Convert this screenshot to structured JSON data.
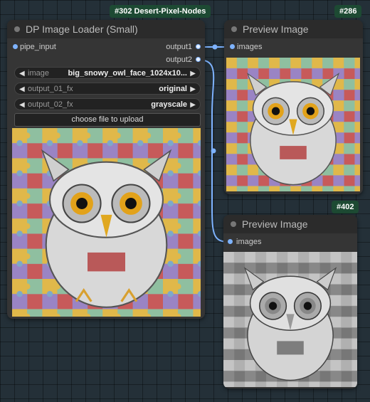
{
  "badges": {
    "group": "#302 Desert-Pixel-Nodes",
    "preview1": "#286",
    "preview2": "#402"
  },
  "loader": {
    "title": "DP Image Loader (Small)",
    "input_slot": "pipe_input",
    "output1": "output1",
    "output2": "output2",
    "widgets": [
      {
        "label": "image",
        "value": "big_snowy_owl_face_1024x10..."
      },
      {
        "label": "output_01_fx",
        "value": "original"
      },
      {
        "label": "output_02_fx",
        "value": "grayscale"
      }
    ],
    "upload_button": "choose file to upload"
  },
  "preview1": {
    "title": "Preview Image",
    "input_slot": "images"
  },
  "preview2": {
    "title": "Preview Image",
    "input_slot": "images"
  },
  "colors": {
    "link": "#7eb3ff",
    "badge": "#1d4a33",
    "node": "#353535"
  }
}
